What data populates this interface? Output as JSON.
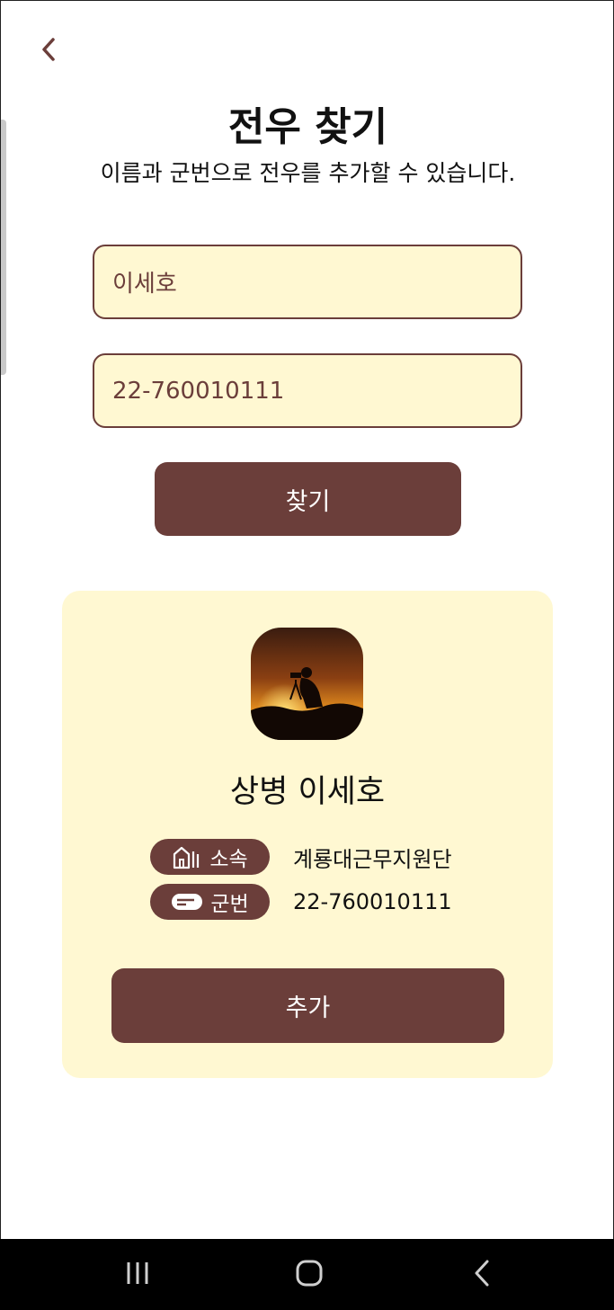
{
  "header": {
    "back_icon": "chevron-left-icon",
    "title": "전우 찾기",
    "subtitle": "이름과 군번으로 전우를 추가할 수 있습니다."
  },
  "search": {
    "name_value": "이세호",
    "number_value": "22-760010111",
    "find_label": "찾기"
  },
  "result": {
    "avatar_icon": "photographer-sunset-photo",
    "rank_name": "상병 이세호",
    "unit_label": "소속",
    "unit_icon": "building-icon",
    "unit_value": "계룡대근무지원단",
    "number_label": "군번",
    "number_icon": "id-card-icon",
    "number_value": "22-760010111",
    "add_label": "추가"
  },
  "nav": {
    "recents_icon": "recents-icon",
    "home_icon": "home-icon",
    "back_icon": "back-icon"
  },
  "colors": {
    "accent": "#6b3e3a",
    "field_bg": "#fff8d2",
    "card_bg": "#fff8d2"
  }
}
